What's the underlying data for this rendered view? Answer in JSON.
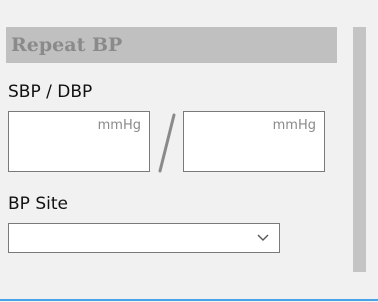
{
  "section": {
    "title": "Repeat BP"
  },
  "bp": {
    "label": "SBP / DBP",
    "sbp": {
      "unit": "mmHg",
      "value": ""
    },
    "separator": "/",
    "dbp": {
      "unit": "mmHg",
      "value": ""
    }
  },
  "site": {
    "label": "BP Site",
    "selected": ""
  },
  "icons": {
    "chevron": "chevron-down-icon"
  },
  "colors": {
    "header_bg": "#c0c0c0",
    "header_text": "#8a8a8a",
    "scrollbar": "#c4c4c4",
    "accent_line": "#4aa3e8"
  }
}
